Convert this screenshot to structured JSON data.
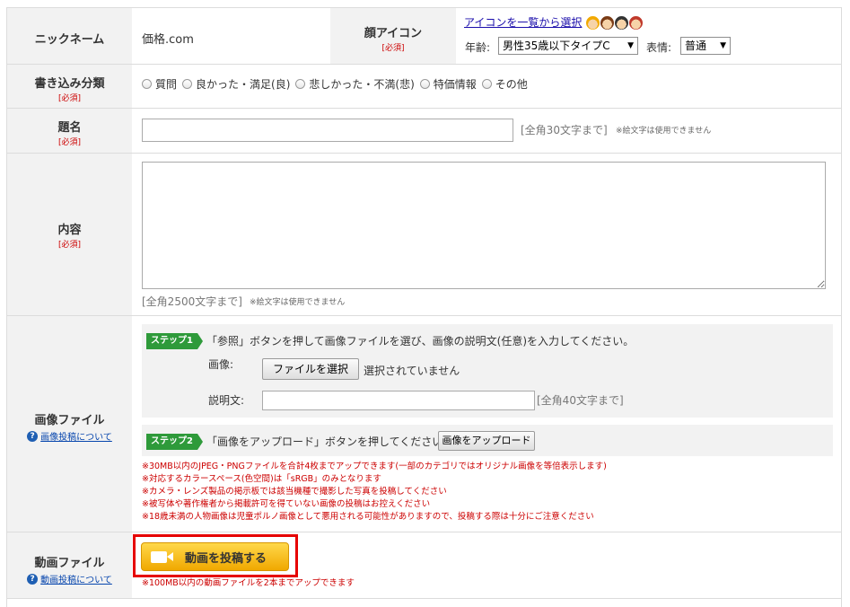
{
  "nickname": {
    "label": "ニックネーム",
    "value": "価格.com"
  },
  "face_icon": {
    "label": "顔アイコン",
    "required": "[必須]",
    "select_link": "アイコンを一覧から選択",
    "icons": [
      "face-icon-boy",
      "face-icon-girl",
      "face-icon-man",
      "face-icon-woman"
    ],
    "age_label": "年齢:",
    "age_value": "男性35歳以下タイプC",
    "expression_label": "表情:",
    "expression_value": "普通"
  },
  "category": {
    "label": "書き込み分類",
    "required": "[必須]",
    "options": [
      "質問",
      "良かった・満足(良)",
      "悲しかった・不満(悲)",
      "特価情報",
      "その他"
    ]
  },
  "title": {
    "label": "題名",
    "required": "[必須]",
    "value": "",
    "limit": "[全角30文字まで]",
    "emoji_note": "※絵文字は使用できません"
  },
  "content": {
    "label": "内容",
    "required": "[必須]",
    "value": "",
    "limit": "[全角2500文字まで]",
    "emoji_note": "※絵文字は使用できません"
  },
  "image_file": {
    "label": "画像ファイル",
    "help_link": "画像投稿について",
    "step1_badge": "ステップ1",
    "step1_text": "「参照」ボタンを押して画像ファイルを選び、画像の説明文(任意)を入力してください。",
    "image_label": "画像:",
    "file_button": "ファイルを選択",
    "file_status": "選択されていません",
    "desc_label": "説明文:",
    "desc_value": "",
    "desc_limit": "[全角40文字まで]",
    "step2_badge": "ステップ2",
    "step2_text": "「画像をアップロード」ボタンを押してください。",
    "upload_button": "画像をアップロード",
    "notes": [
      "※30MB以内のJPEG・PNGファイルを合計4枚までアップできます(一部のカテゴリではオリジナル画像を等倍表示します)",
      "※対応するカラースペース(色空間)は「sRGB」のみとなります",
      "※カメラ・レンズ製品の掲示板では該当機種で撮影した写真を投稿してください",
      "※被写体や著作権者から掲載許可を得ていない画像の投稿はお控えください",
      "※18歳未満の人物画像は児童ポルノ画像として悪用される可能性がありますので、投稿する際は十分にご注意ください"
    ]
  },
  "video_file": {
    "label": "動画ファイル",
    "help_link": "動画投稿について",
    "post_button": "動画を投稿する",
    "note": "※100MB以内の動画ファイルを2本までアップできます"
  },
  "colors": {
    "required": "#cc0000",
    "step_badge": "#2e9a3a",
    "video_button": "#f5b800",
    "highlight": "#e60000",
    "label_bg": "#f2f2f2"
  }
}
